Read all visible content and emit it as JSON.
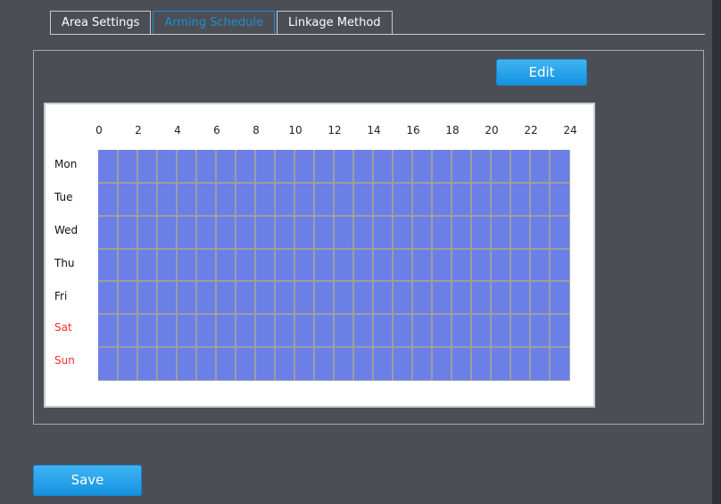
{
  "tabs": [
    {
      "label": "Area Settings",
      "active": false
    },
    {
      "label": "Arming Schedule",
      "active": true
    },
    {
      "label": "Linkage Method",
      "active": false
    }
  ],
  "buttons": {
    "edit": "Edit",
    "save": "Save"
  },
  "schedule": {
    "hour_labels": [
      "0",
      "2",
      "4",
      "6",
      "8",
      "10",
      "12",
      "14",
      "16",
      "18",
      "20",
      "22",
      "24"
    ],
    "days": [
      {
        "label": "Mon",
        "weekend": false
      },
      {
        "label": "Tue",
        "weekend": false
      },
      {
        "label": "Wed",
        "weekend": false
      },
      {
        "label": "Thu",
        "weekend": false
      },
      {
        "label": "Fri",
        "weekend": false
      },
      {
        "label": "Sat",
        "weekend": true
      },
      {
        "label": "Sun",
        "weekend": true
      }
    ],
    "armed_all_day": true
  },
  "colors": {
    "background": "#4b4e55",
    "active_tab": "#1f8fd0",
    "armed_cell": "#6c7fe6",
    "weekend_label": "#ff2a2a",
    "button": "#1592e0"
  }
}
